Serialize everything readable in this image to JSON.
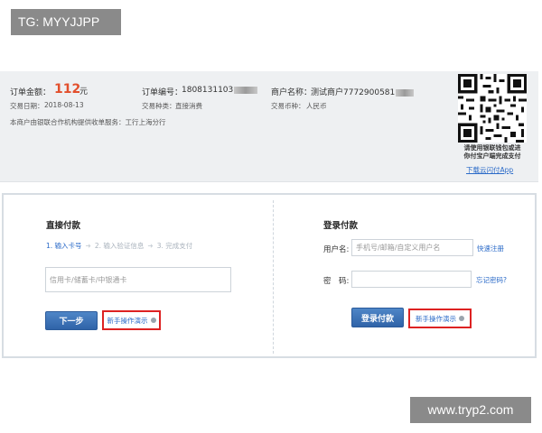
{
  "watermarks": {
    "top": "TG: MYYJJPP",
    "bottom": "www.tryp2.com"
  },
  "order": {
    "amount_label": "订单金额：",
    "amount_value": "112",
    "amount_unit": "元",
    "date_label": "交易日期：",
    "date_value": "2018-08-13",
    "order_no_label": "订单编号：",
    "order_no_value": "1808131103",
    "type_label": "交易种类：",
    "type_value": "直接消费",
    "merchant_label": "商户名称：",
    "merchant_value": "测试商户7772900581",
    "currency_label": "交易币种：",
    "currency_value": "人民币",
    "service_note": "本商户由银联合作机构提供收单服务：工行上海分行"
  },
  "qr": {
    "caption_line1": "请使用银联钱包或进",
    "caption_line2": "你付宝户端完成支付",
    "download_link": "下载云闪付App"
  },
  "direct_pay": {
    "title": "直接付款",
    "steps": [
      "1. 输入卡号",
      "2. 输入验证信息",
      "3. 完成支付"
    ],
    "card_placeholder": "信用卡/储蓄卡/中银通卡",
    "next_button": "下一步",
    "help_link": "新手操作演示"
  },
  "login_pay": {
    "title": "登录付款",
    "username_label": "用户名:",
    "username_placeholder": "手机号/邮箱/自定义用户名",
    "register_link": "快速注册",
    "password_label": "密　码:",
    "forgot_link": "忘记密码?",
    "login_button": "登录付款",
    "help_link": "新手操作演示"
  },
  "colors": {
    "accent": "#2f63a8",
    "amount": "#e24f2c",
    "highlight_border": "#dd2222"
  }
}
